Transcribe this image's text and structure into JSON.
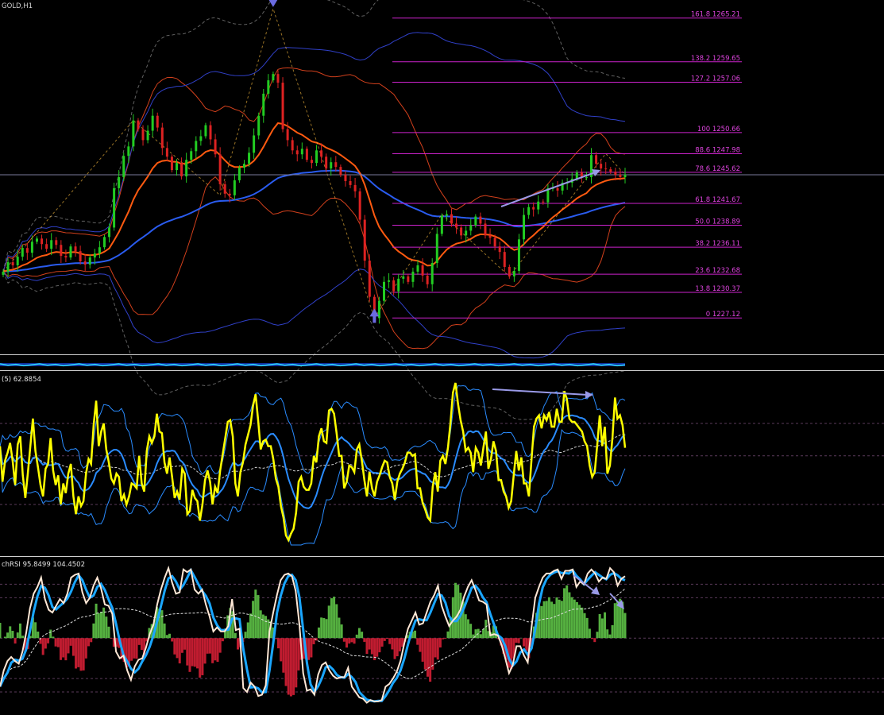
{
  "window": {
    "title": "GOLD,H1"
  },
  "colors": {
    "background": "#000000",
    "bull": "#22cc22",
    "bear": "#dd2222",
    "fib": "#cc22cc",
    "fib_text": "#dd44dd",
    "ma_orange": "#ff5a10",
    "envelope_red": "#d2401c",
    "band_blue": "#3040c8",
    "ma_blue": "#2a5cf0",
    "rsi_yellow": "#ffff00",
    "rsi_blue": "#2a8cff",
    "stoch_cream": "#ffe8d6",
    "stoch_blue": "#1aa6ff",
    "hist_green": "#55b040",
    "hist_red": "#c01c30",
    "arrow": "#6a6ae0",
    "trend_line": "#9a9ae8"
  },
  "indicator_labels": {
    "rsi": "(5) 62.8854",
    "stochrsi": "chRSI 95.8499 104.4502"
  },
  "chart_data": {
    "type": "line",
    "title": "GOLD,H1",
    "ylim": [
      1222.5,
      1267.5
    ],
    "candles_count": 130,
    "price_series": [
      1233.0,
      1234.2,
      1233.8,
      1234.9,
      1236.0,
      1235.4,
      1236.8,
      1237.2,
      1236.5,
      1235.9,
      1237.0,
      1236.4,
      1235.0,
      1234.8,
      1236.2,
      1235.6,
      1234.3,
      1233.9,
      1234.8,
      1235.3,
      1236.1,
      1237.4,
      1238.6,
      1243.6,
      1245.0,
      1247.7,
      1248.9,
      1252.2,
      1251.1,
      1249.7,
      1250.9,
      1252.8,
      1251.3,
      1248.7,
      1247.6,
      1245.9,
      1246.8,
      1245.1,
      1247.2,
      1248.3,
      1249.6,
      1250.2,
      1251.6,
      1249.8,
      1247.9,
      1244.1,
      1242.9,
      1242.7,
      1244.6,
      1246.2,
      1246.7,
      1248.1,
      1250.3,
      1252.8,
      1255.6,
      1257.3,
      1258.1,
      1257.0,
      1251.1,
      1249.7,
      1248.4,
      1247.9,
      1248.6,
      1247.2,
      1246.8,
      1248.4,
      1247.6,
      1246.1,
      1246.9,
      1246.3,
      1245.3,
      1244.5,
      1244.0,
      1243.2,
      1239.6,
      1234.4,
      1229.8,
      1227.1,
      1229.3,
      1231.7,
      1231.9,
      1230.5,
      1232.1,
      1232.4,
      1231.7,
      1233.0,
      1233.8,
      1232.5,
      1231.4,
      1234.1,
      1237.8,
      1240.1,
      1240.3,
      1239.1,
      1238.6,
      1237.6,
      1238.2,
      1238.9,
      1240.0,
      1239.1,
      1237.6,
      1237.3,
      1236.2,
      1235.5,
      1233.6,
      1232.4,
      1233.1,
      1237.1,
      1240.2,
      1241.2,
      1240.9,
      1241.9,
      1241.8,
      1243.6,
      1243.6,
      1243.3,
      1244.3,
      1244.3,
      1244.8,
      1245.6,
      1245.0,
      1245.0,
      1247.8,
      1246.7,
      1246.1,
      1246.0,
      1245.7,
      1245.3,
      1245.0,
      1245.3
    ],
    "fibonacci_levels": [
      {
        "ratio": "161.8",
        "price": "1265.21"
      },
      {
        "ratio": "138.2",
        "price": "1259.65"
      },
      {
        "ratio": "127.2",
        "price": "1257.06"
      },
      {
        "ratio": "100",
        "price": "1250.66"
      },
      {
        "ratio": "88.6",
        "price": "1247.98"
      },
      {
        "ratio": "78.6",
        "price": "1245.62"
      },
      {
        "ratio": "61.8",
        "price": "1241.67"
      },
      {
        "ratio": "50.0",
        "price": "1238.89"
      },
      {
        "ratio": "38.2",
        "price": "1236.11"
      },
      {
        "ratio": "23.6",
        "price": "1232.68"
      },
      {
        "ratio": "13.8",
        "price": "1230.37"
      },
      {
        "ratio": "0",
        "price": "1227.12"
      }
    ],
    "rsi": {
      "ylim": [
        0,
        100
      ],
      "last_value": 62.8854,
      "values": [
        61,
        39,
        52,
        57,
        63,
        52,
        37,
        62,
        67,
        43,
        29,
        44,
        61,
        78,
        58,
        48,
        37,
        30,
        47,
        50,
        66,
        46,
        37,
        43,
        25,
        38,
        32,
        44,
        50,
        30,
        19,
        30,
        24,
        27,
        44,
        53,
        50,
        74,
        89,
        61,
        70,
        75,
        59,
        51,
        41,
        38,
        44,
        42,
        27,
        31,
        25,
        30,
        38,
        37,
        35,
        55,
        38,
        33,
        58,
        67,
        63,
        67,
        81,
        70,
        69,
        51,
        44,
        54,
        42,
        29,
        33,
        28,
        47,
        44,
        19,
        21,
        34,
        29,
        27,
        15,
        25,
        40,
        46,
        39,
        25,
        36,
        32,
        46,
        56,
        66,
        76,
        77,
        67,
        38,
        30,
        45,
        51,
        62,
        68,
        74,
        86,
        93,
        77,
        59,
        64,
        65,
        61,
        61,
        53,
        41,
        36,
        24,
        17,
        6,
        3,
        7,
        10,
        20,
        39,
        42,
        36,
        34,
        34,
        38,
        55,
        51,
        67,
        72,
        64,
        63,
        83,
        84,
        81,
        69,
        55,
        55,
        35,
        39,
        49,
        48,
        45,
        59,
        62,
        52,
        40,
        30,
        45,
        35,
        30,
        39,
        43,
        48,
        52,
        51,
        42,
        38,
        28,
        39,
        44,
        47,
        51,
        57,
        57,
        55,
        56,
        35,
        35,
        26,
        22,
        17,
        15,
        36,
        45,
        33,
        52,
        55,
        50,
        60,
        75,
        94,
        100,
        87,
        77,
        70,
        58,
        60,
        57,
        45,
        60,
        57,
        49,
        60,
        70,
        47,
        53,
        64,
        58,
        40,
        40,
        33,
        30,
        23,
        27,
        43,
        58,
        46,
        54,
        38,
        38,
        30,
        52,
        73,
        78,
        80,
        72,
        80,
        77,
        82,
        73,
        73,
        84,
        76,
        76,
        95,
        90,
        78,
        76,
        76,
        74,
        72,
        70,
        64,
        61,
        49,
        42,
        45,
        62,
        80,
        61,
        73,
        44,
        49,
        66,
        91,
        78,
        80,
        74,
        60
      ]
    },
    "stochrsi": {
      "ylim": [
        0,
        100
      ],
      "k_last": 95.8499,
      "d_last": 104.4502,
      "k_values": [
        14,
        26,
        33,
        36,
        33,
        31,
        40,
        54,
        72,
        83,
        88,
        95,
        79,
        71,
        69,
        74,
        79,
        76,
        83,
        95,
        97,
        98,
        84,
        76,
        80,
        89,
        95,
        87,
        75,
        74,
        68,
        40,
        35,
        37,
        26,
        19,
        29,
        34,
        35,
        43,
        53,
        60,
        75,
        86,
        95,
        102,
        91,
        83,
        84,
        101,
        99,
        101,
        86,
        83,
        86,
        75,
        66,
        55,
        58,
        55,
        55,
        59,
        79,
        56,
        57,
        13,
        10,
        17,
        14,
        7,
        8,
        15,
        55,
        69,
        82,
        93,
        97,
        98,
        96,
        85,
        60,
        24,
        11,
        12,
        8,
        23,
        30,
        32,
        26,
        22,
        20,
        21,
        21,
        28,
        14,
        10,
        6,
        5,
        2,
        4,
        3,
        3,
        4,
        14,
        16,
        20,
        25,
        33,
        46,
        57,
        63,
        69,
        60,
        61,
        69,
        77,
        82,
        89,
        74,
        66,
        59,
        63,
        66,
        71,
        81,
        88,
        93,
        86,
        78,
        77,
        75,
        52,
        53,
        52,
        45,
        35,
        24,
        30,
        44,
        44,
        37,
        32,
        58,
        80,
        88,
        95,
        98,
        98,
        100,
        101,
        94,
        100,
        100,
        101,
        88,
        92,
        90,
        98,
        101,
        98,
        92,
        95,
        94,
        102,
        99,
        89,
        94,
        96
      ]
    }
  }
}
